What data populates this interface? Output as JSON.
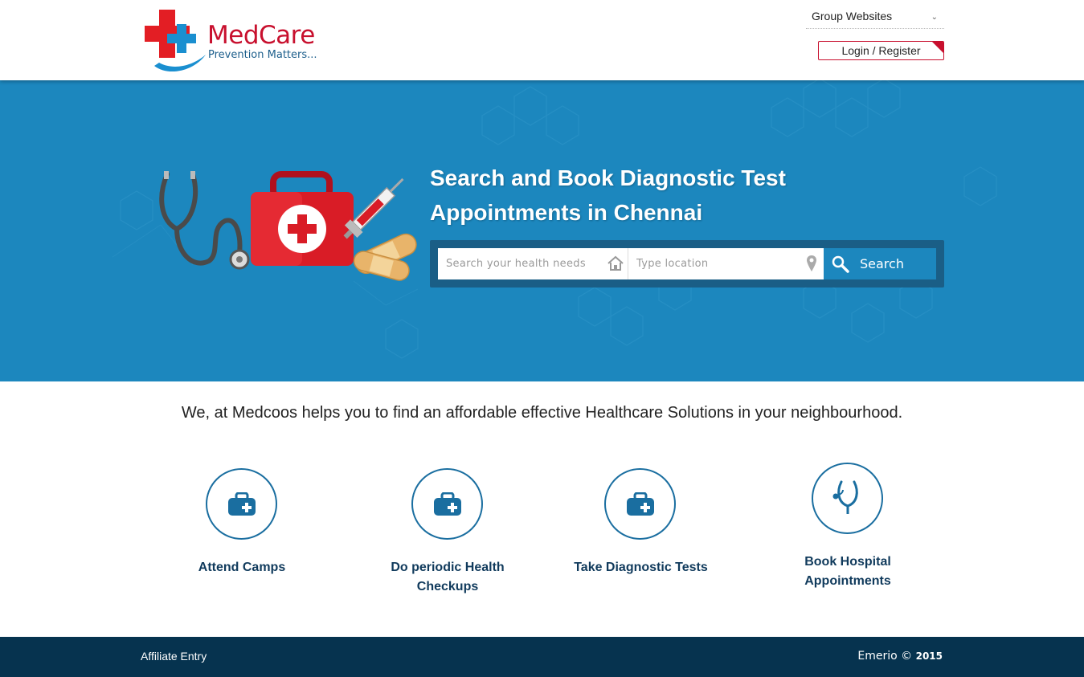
{
  "brand": {
    "name": "MedCare",
    "tagline": "Prevention Matters..."
  },
  "header": {
    "group_websites_label": "Group Websites",
    "login_label": "Login / Register"
  },
  "hero": {
    "title_line1": "Search and Book Diagnostic Test",
    "title_line2": "Appointments in Chennai",
    "search_placeholder": "Search your health needs",
    "location_placeholder": "Type location",
    "search_button_label": "Search"
  },
  "intro_text": "We, at Medcoos helps you to find an affordable effective Healthcare Solutions in your neighbourhood.",
  "features": [
    {
      "line1": "Attend Camps",
      "line2": "",
      "icon": "medical-kit-icon"
    },
    {
      "line1": "Do periodic Health",
      "line2": "Checkups",
      "icon": "medical-kit-icon"
    },
    {
      "line1": "Take Diagnostic Tests",
      "line2": "",
      "icon": "medical-kit-icon"
    },
    {
      "line1": "Book Hospital",
      "line2": "Appointments",
      "icon": "stethoscope-icon"
    }
  ],
  "footer": {
    "affiliate_label": "Affiliate Entry",
    "copyright_brand": "Emerio",
    "copyright_symbol": "©",
    "copyright_year": "2015"
  },
  "colors": {
    "hero_bg": "#1c87be",
    "brand_red": "#c8102e",
    "brand_blue": "#1d5f8c",
    "footer_bg": "#06334f",
    "feature_text": "#103a5c"
  }
}
